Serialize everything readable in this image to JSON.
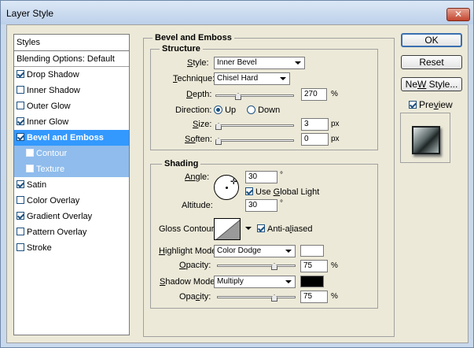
{
  "window": {
    "title": "Layer Style",
    "close_glyph": "✕"
  },
  "sidebar": {
    "header": "Styles",
    "items": [
      {
        "label": "Blending Options: Default",
        "checkbox": null,
        "state": "normal"
      },
      {
        "label": "Drop Shadow",
        "checkbox": true,
        "state": "normal"
      },
      {
        "label": "Inner Shadow",
        "checkbox": false,
        "state": "normal"
      },
      {
        "label": "Outer Glow",
        "checkbox": false,
        "state": "normal"
      },
      {
        "label": "Inner Glow",
        "checkbox": true,
        "state": "normal"
      },
      {
        "label": "Bevel and Emboss",
        "checkbox": true,
        "state": "selected"
      },
      {
        "label": "Contour",
        "checkbox": true,
        "state": "sub"
      },
      {
        "label": "Texture",
        "checkbox": false,
        "state": "sub"
      },
      {
        "label": "Satin",
        "checkbox": true,
        "state": "normal"
      },
      {
        "label": "Color Overlay",
        "checkbox": false,
        "state": "normal"
      },
      {
        "label": "Gradient Overlay",
        "checkbox": true,
        "state": "normal"
      },
      {
        "label": "Pattern Overlay",
        "checkbox": false,
        "state": "normal"
      },
      {
        "label": "Stroke",
        "checkbox": false,
        "state": "normal"
      }
    ]
  },
  "panel": {
    "title": "Bevel and Emboss",
    "structure": {
      "title": "Structure",
      "style_label_u": "S",
      "style_label_rest": "tyle:",
      "style_value": "Inner Bevel",
      "technique_label_u": "T",
      "technique_label_rest": "echnique:",
      "technique_value": "Chisel Hard",
      "depth_label_u": "D",
      "depth_label_rest": "epth:",
      "depth_value": "270",
      "depth_unit": "%",
      "depth_slider": 0.27,
      "direction_label": "Direction:",
      "direction_up": "Up",
      "direction_down": "Down",
      "direction_selected": "Up",
      "size_label_u": "S",
      "size_label_rest": "ize:",
      "size_value": "3",
      "size_unit": "px",
      "size_slider": 0.0,
      "soften_label_u": "So",
      "soften_label_rest": "ften:",
      "soften_value": "0",
      "soften_unit": "px",
      "soften_slider": 0.0
    },
    "shading": {
      "title": "Shading",
      "angle_label_u": "An",
      "angle_label_rest": "gle:",
      "angle_value": "30",
      "angle_unit": "°",
      "global_light_label_pre": "Use ",
      "global_light_label_u": "G",
      "global_light_label_rest": "lobal Light",
      "global_light_checked": true,
      "altitude_label": "Altitude:",
      "altitude_value": "30",
      "altitude_unit": "°",
      "gloss_label": "Gloss Contour:",
      "anti_aliased_label_pre": "Anti-a",
      "anti_aliased_label_u": "l",
      "anti_aliased_label_rest": "iased",
      "anti_aliased_checked": true,
      "highlight_mode_label_u": "H",
      "highlight_mode_label_rest": "ighlight Mode:",
      "highlight_mode_value": "Color Dodge",
      "highlight_color": "#ffffff",
      "highlight_opacity_label_u": "O",
      "highlight_opacity_label_rest": "pacity:",
      "highlight_opacity_value": "75",
      "highlight_opacity_unit": "%",
      "highlight_opacity_slider": 0.75,
      "shadow_mode_label_u": "S",
      "shadow_mode_label_rest": "hadow Mode:",
      "shadow_mode_value": "Multiply",
      "shadow_color": "#000000",
      "shadow_opacity_label_pre": "Opa",
      "shadow_opacity_label_u": "c",
      "shadow_opacity_label_rest": "ity:",
      "shadow_opacity_value": "75",
      "shadow_opacity_unit": "%",
      "shadow_opacity_slider": 0.75
    }
  },
  "buttons": {
    "ok": "OK",
    "reset": "Reset",
    "new_style_u": "W",
    "new_style_pre": "Ne",
    "new_style_rest": " Style...",
    "preview_label_pre": "Pre",
    "preview_label_u": "v",
    "preview_label_rest": "iew",
    "preview_checked": true
  }
}
